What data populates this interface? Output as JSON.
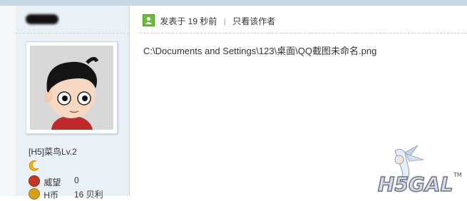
{
  "post": {
    "header_prefix": "发表于 19 秒前",
    "only_author_link": "只看该作者",
    "content": "C:\\Documents and Settings\\123\\桌面\\QQ截图未命名.png"
  },
  "user": {
    "level": "[H5]菜鸟Lv.2",
    "stats": [
      {
        "label": "威望",
        "value": "0",
        "icon": "medal-icon",
        "color": "#c0392b"
      },
      {
        "label": "H币",
        "value": "16 贝利",
        "icon": "coin-icon",
        "color": "#d4a017"
      }
    ]
  },
  "watermark": {
    "text": "H5GAL",
    "tm": "TM"
  },
  "colors": {
    "sidebar_bg": "#e9f0f6",
    "accent_green": "#6dbb3c"
  }
}
